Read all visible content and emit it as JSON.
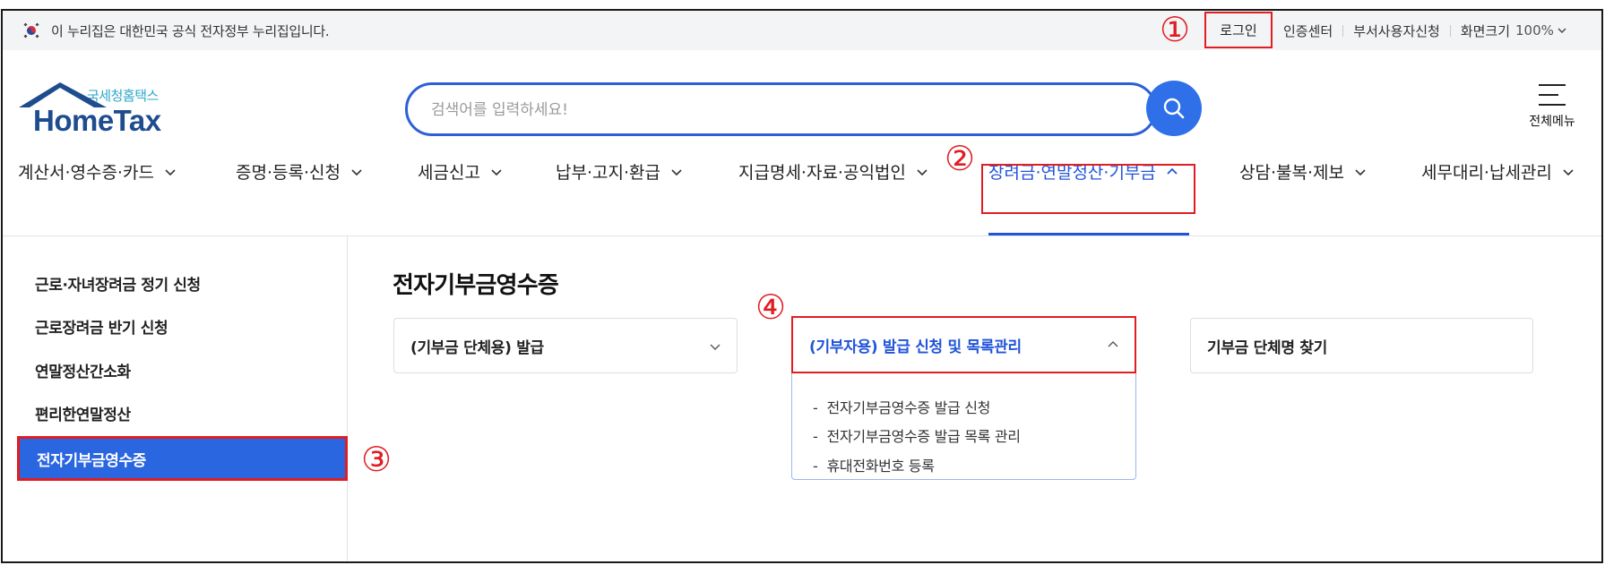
{
  "gov_banner": {
    "text": "이 누리집은 대한민국 공식 전자정부 누리집입니다."
  },
  "utility": {
    "login": "로그인",
    "cert_center": "인증센터",
    "dept_user": "부서사용자신청",
    "screen_size_label": "화면크기",
    "zoom": "100%"
  },
  "annotations": {
    "n1": "①",
    "n2": "②",
    "n3": "③",
    "n4": "④"
  },
  "logo": {
    "sub": "국세청홈택스",
    "main": "HomeTax"
  },
  "search": {
    "placeholder": "검색어를 입력하세요!"
  },
  "all_menu_label": "전체메뉴",
  "gnb": [
    {
      "label": "계산서·영수증·카드"
    },
    {
      "label": "증명·등록·신청"
    },
    {
      "label": "세금신고"
    },
    {
      "label": "납부·고지·환급"
    },
    {
      "label": "지급명세·자료·공익법인"
    },
    {
      "label": "장려금·연말정산·기부금"
    },
    {
      "label": "상담·불복·제보"
    },
    {
      "label": "세무대리·납세관리"
    }
  ],
  "sidebar": {
    "items": [
      {
        "label": "근로·자녀장려금 정기 신청"
      },
      {
        "label": "근로장려금 반기 신청"
      },
      {
        "label": "연말정산간소화"
      },
      {
        "label": "편리한연말정산"
      },
      {
        "label": "전자기부금영수증"
      }
    ]
  },
  "content": {
    "title": "전자기부금영수증",
    "card1": "(기부금 단체용) 발급",
    "card2": "(기부자용) 발급 신청 및 목록관리",
    "card2_links": [
      "전자기부금영수증 발급 신청",
      "전자기부금영수증 발급 목록 관리",
      "휴대전화번호 등록"
    ],
    "card3": "기부금 단체명 찾기"
  },
  "colors": {
    "accent": "#2154d8",
    "highlight": "#e11d22",
    "logo_blue": "#1e4c8f",
    "logo_teal": "#2aa7c9"
  }
}
